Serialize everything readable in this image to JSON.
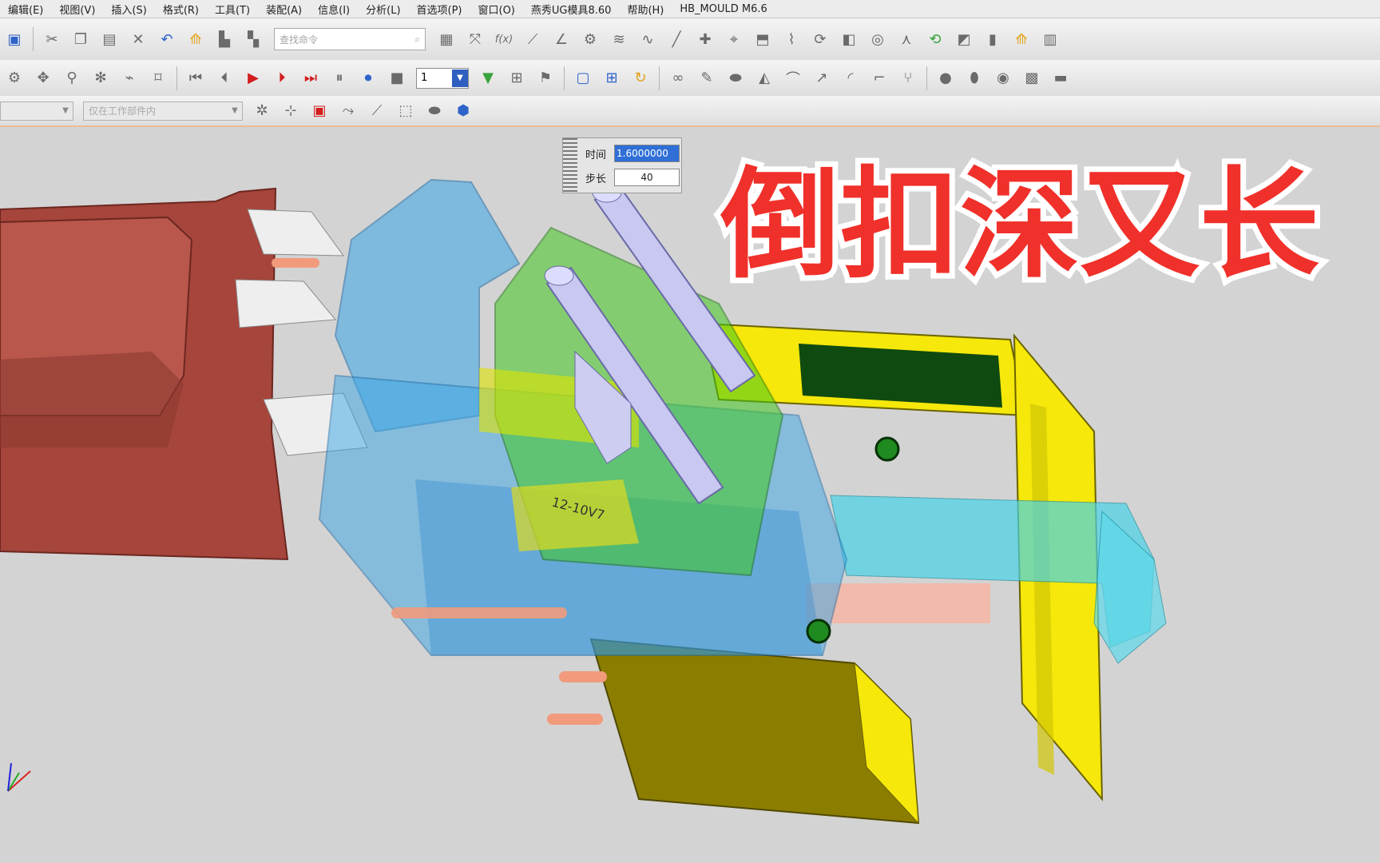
{
  "menu": [
    "编辑(E)",
    "视图(V)",
    "插入(S)",
    "格式(R)",
    "工具(T)",
    "装配(A)",
    "信息(I)",
    "分析(L)",
    "首选项(P)",
    "窗口(O)",
    "燕秀UG模具8.60",
    "帮助(H)",
    "HB_MOULD M6.6"
  ],
  "toolbar": {
    "command_search_placeholder": "查找命令",
    "step_value": "1"
  },
  "toolbar3": {
    "combo1": "",
    "combo2": "仅在工作部件内"
  },
  "anim_dialog": {
    "time_label": "时间",
    "time_value": "1.6000000",
    "step_label": "步长",
    "step_value": "40"
  },
  "overlay_title": "倒扣深又长",
  "part_text": "12-10V7",
  "colors": {
    "headline_red": "#f0302a",
    "plate_yellow": "#f5e80a",
    "part_red": "#a5453b",
    "transparent_blue": "#3aa6e6",
    "cyan": "#48d3e8",
    "green": "#42c81e"
  }
}
